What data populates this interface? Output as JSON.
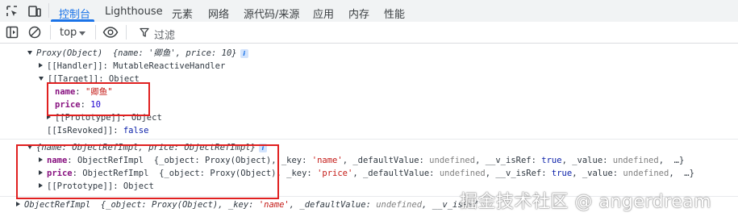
{
  "tabs": [
    "控制台",
    "Lighthouse",
    "元素",
    "网络",
    "源代码/来源",
    "应用",
    "内存",
    "性能"
  ],
  "toolbar": {
    "context": "top",
    "filter_placeholder": "过滤"
  },
  "console": {
    "proxy_header_type": "Proxy(Object)",
    "proxy_header_preview": "{name: '卿鱼', price: 10}",
    "handler_key": "[[Handler]]",
    "handler_value": "MutableReactiveHandler",
    "target_key": "[[Target]]",
    "target_value": "Object",
    "name_key": "name",
    "name_value": "\"卿鱼\"",
    "price_key": "price",
    "price_value": "10",
    "prototype_key": "[[Prototype]]",
    "prototype_value": "Object",
    "revoked_key": "[[IsRevoked]]",
    "revoked_value": "false",
    "refs_header": "{name: ObjectRefImpl, price: ObjectRefImpl}",
    "ref_name_key": "name",
    "ref_price_key": "price",
    "ref_type": "ObjectRefImpl",
    "ref_obj_part": "{_object: Proxy(Object), _key: ",
    "ref_name_str": "'name'",
    "ref_price_str": "'price'",
    "ref_default_part": ", _defaultValue: ",
    "undefined": "undefined",
    "ref_isref_part": ", __v_isRef: ",
    "true": "true",
    "ref_value_part": ", _value: ",
    "ellipsis": "…}",
    "ref_proto_key": "[[Prototype]]",
    "ref_proto_value": "Object",
    "last_type": "ObjectRefImpl",
    "last_obj_part": "{_object: Proxy(Object), _key: ",
    "last_name_str": "'name'",
    "last_default_part": ", _defaultValue: ",
    "last_undefined": "undefined",
    "last_isref_part": ", __v_isRef"
  },
  "watermark": "掘金技术社区 @ angerdream"
}
